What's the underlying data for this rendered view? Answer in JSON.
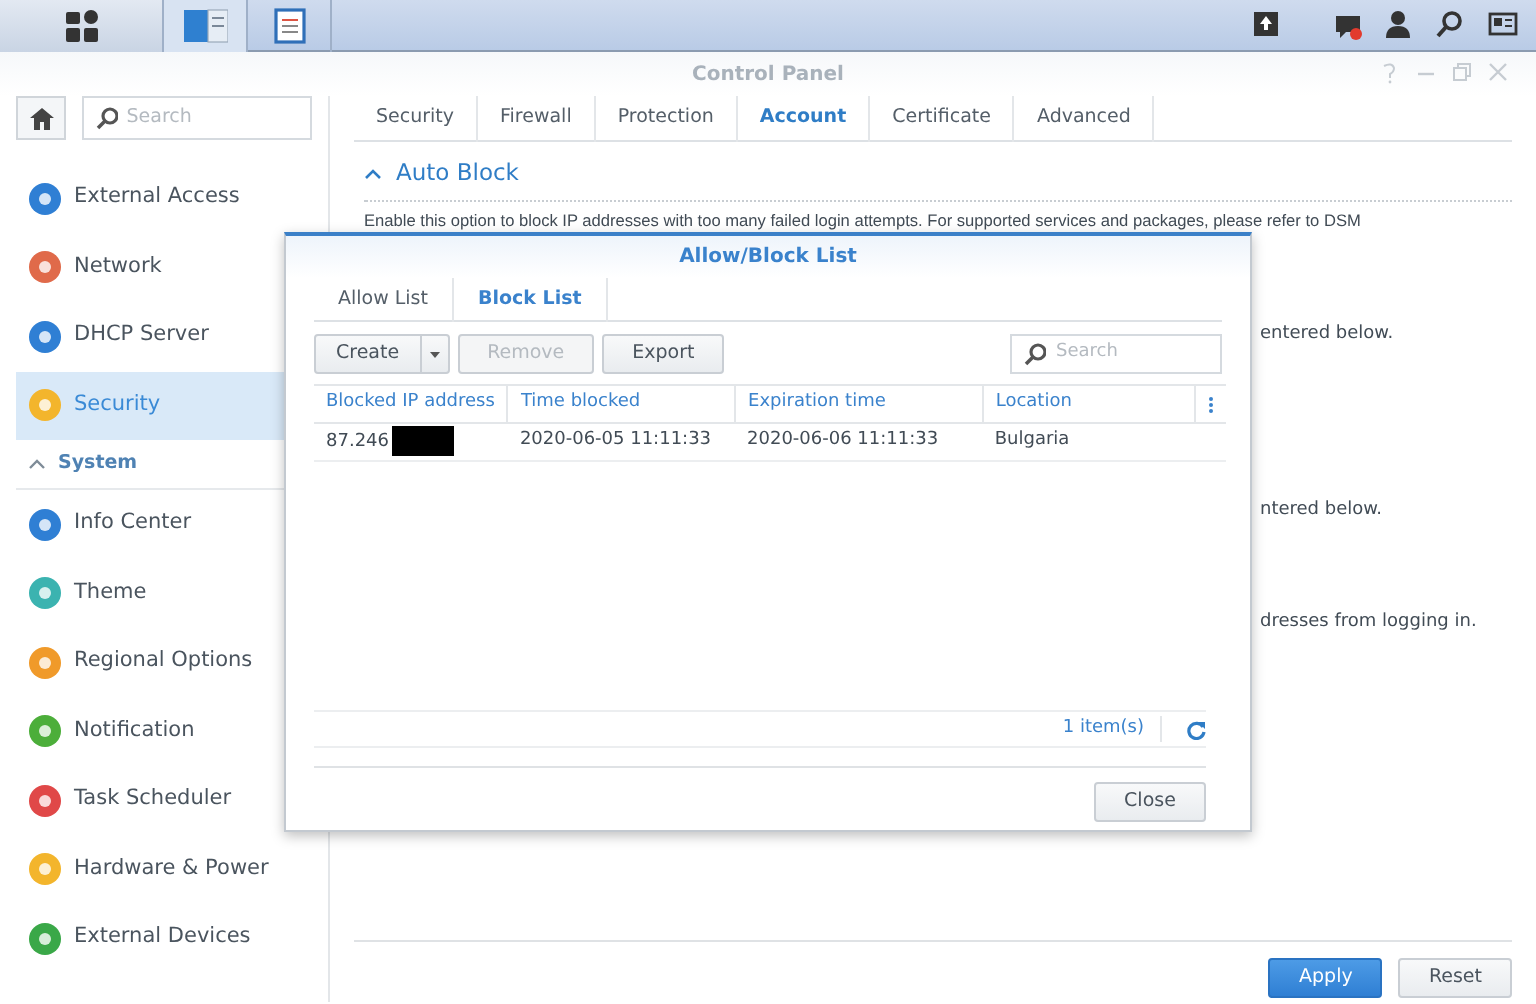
{
  "window": {
    "title": "Control Panel"
  },
  "sidebar": {
    "search_placeholder": "Search",
    "items": [
      {
        "kind": "item",
        "label": "External Access",
        "selected": false
      },
      {
        "kind": "item",
        "label": "Network",
        "selected": false
      },
      {
        "kind": "item",
        "label": "DHCP Server",
        "selected": false
      },
      {
        "kind": "item",
        "label": "Security",
        "selected": true
      },
      {
        "kind": "section",
        "label": "System",
        "expanded": true
      },
      {
        "kind": "item",
        "label": "Info Center",
        "selected": false
      },
      {
        "kind": "item",
        "label": "Theme",
        "selected": false
      },
      {
        "kind": "item",
        "label": "Regional Options",
        "selected": false
      },
      {
        "kind": "item",
        "label": "Notification",
        "selected": false
      },
      {
        "kind": "item",
        "label": "Task Scheduler",
        "selected": false
      },
      {
        "kind": "item",
        "label": "Hardware & Power",
        "selected": false
      },
      {
        "kind": "item",
        "label": "External Devices",
        "selected": false
      }
    ]
  },
  "main": {
    "tabs": [
      {
        "label": "Security",
        "selected": false
      },
      {
        "label": "Firewall",
        "selected": false
      },
      {
        "label": "Protection",
        "selected": false
      },
      {
        "label": "Account",
        "selected": true
      },
      {
        "label": "Certificate",
        "selected": false
      },
      {
        "label": "Advanced",
        "selected": false
      }
    ],
    "section": {
      "title": "Auto Block",
      "expanded": true
    },
    "description": "Enable this option to block IP addresses with too many failed login attempts. For supported services and packages, please refer to DSM",
    "fragments": [
      "entered below.",
      "ntered below.",
      "dresses from logging in."
    ],
    "buttons": [
      {
        "label": "Apply",
        "kind": "primary"
      },
      {
        "label": "Reset",
        "kind": "default"
      }
    ]
  },
  "dialog": {
    "title": "Allow/Block List",
    "tabs": [
      {
        "label": "Allow List",
        "selected": false
      },
      {
        "label": "Block List",
        "selected": true
      }
    ],
    "toolbar": [
      {
        "label": "Create",
        "kind": "split",
        "disabled": false
      },
      {
        "label": "Remove",
        "kind": "button",
        "disabled": true
      },
      {
        "label": "Export",
        "kind": "button",
        "disabled": false
      }
    ],
    "search_placeholder": "Search",
    "columns": [
      "Blocked IP address",
      "Time blocked",
      "Expiration time",
      "Location"
    ],
    "rows": [
      {
        "cells": [
          "87.246",
          "2020-06-05 11:11:33",
          "2020-06-06 11:11:33",
          "Bulgaria"
        ],
        "redacted": true
      }
    ],
    "count": "1 item(s)",
    "close": "Close"
  }
}
